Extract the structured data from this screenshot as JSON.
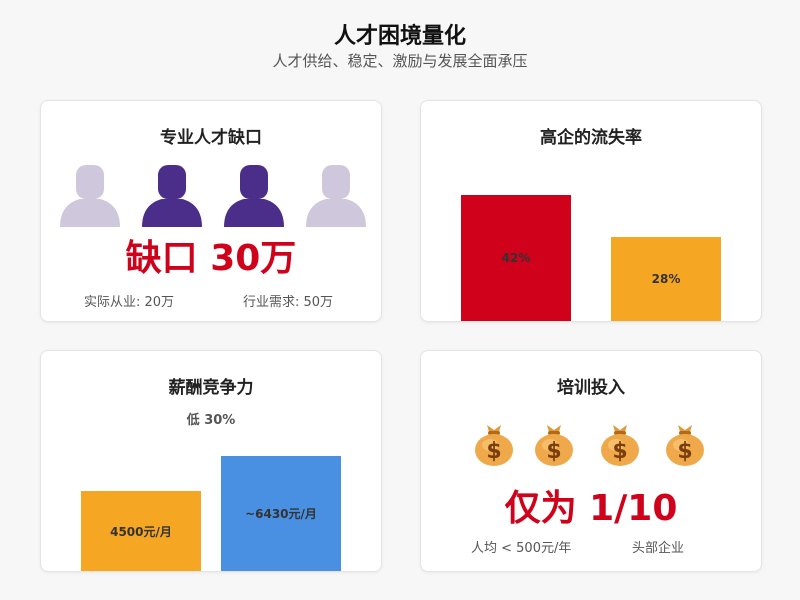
{
  "header": {
    "title": "人才困境量化",
    "subtitle": "人才供给、稳定、激励与发展全面承压"
  },
  "cards": {
    "talent_gap": {
      "title": "专业人才缺口",
      "headline": "缺口 30万",
      "actual": "实际从业: 20万",
      "demand": "行业需求: 50万",
      "icons": [
        "person-icon",
        "person-icon",
        "person-icon",
        "person-icon"
      ],
      "highlighted_people": 2
    },
    "turnover": {
      "title": "高企的流失率"
    },
    "salary": {
      "title": "薪酬竞争力",
      "note": "低 30%"
    },
    "training": {
      "title": "培训投入",
      "headline": "仅为 1/10",
      "left_caption": "人均 < 500元/年",
      "right_caption": "头部企业",
      "icons": [
        "money-bag-icon",
        "money-bag-icon",
        "money-bag-icon",
        "money-bag-icon"
      ]
    }
  },
  "colors": {
    "accent_red": "#d0021b",
    "orange": "#f5a623",
    "blue": "#4a90e2",
    "purple": "#4b2d8a",
    "muted_person": "#cfc8dc"
  },
  "chart_data": [
    {
      "type": "bar",
      "title": "高企的流失率",
      "categories": [
        "",
        ""
      ],
      "values": [
        42,
        28
      ],
      "labels": [
        "42%",
        "28%"
      ],
      "colors": [
        "#d0021b",
        "#f5a623"
      ],
      "ylim": [
        0,
        50
      ]
    },
    {
      "type": "bar",
      "title": "薪酬竞争力",
      "categories": [
        "",
        ""
      ],
      "values": [
        4500,
        6430
      ],
      "labels": [
        "4500元/月",
        "~6430元/月"
      ],
      "colors": [
        "#f5a623",
        "#4a90e2"
      ],
      "ylim": [
        0,
        8400
      ]
    }
  ]
}
